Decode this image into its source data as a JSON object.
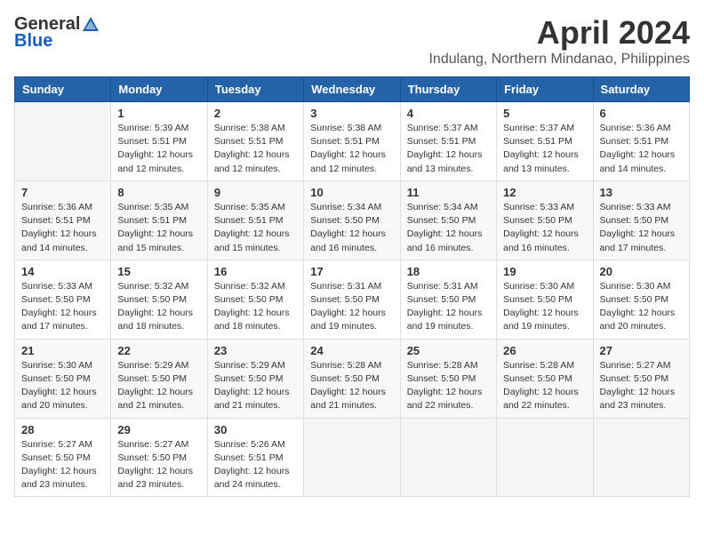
{
  "logo": {
    "general": "General",
    "blue": "Blue"
  },
  "title": "April 2024",
  "location": "Indulang, Northern Mindanao, Philippines",
  "days_of_week": [
    "Sunday",
    "Monday",
    "Tuesday",
    "Wednesday",
    "Thursday",
    "Friday",
    "Saturday"
  ],
  "weeks": [
    [
      {
        "day": "",
        "info": ""
      },
      {
        "day": "1",
        "info": "Sunrise: 5:39 AM\nSunset: 5:51 PM\nDaylight: 12 hours\nand 12 minutes."
      },
      {
        "day": "2",
        "info": "Sunrise: 5:38 AM\nSunset: 5:51 PM\nDaylight: 12 hours\nand 12 minutes."
      },
      {
        "day": "3",
        "info": "Sunrise: 5:38 AM\nSunset: 5:51 PM\nDaylight: 12 hours\nand 12 minutes."
      },
      {
        "day": "4",
        "info": "Sunrise: 5:37 AM\nSunset: 5:51 PM\nDaylight: 12 hours\nand 13 minutes."
      },
      {
        "day": "5",
        "info": "Sunrise: 5:37 AM\nSunset: 5:51 PM\nDaylight: 12 hours\nand 13 minutes."
      },
      {
        "day": "6",
        "info": "Sunrise: 5:36 AM\nSunset: 5:51 PM\nDaylight: 12 hours\nand 14 minutes."
      }
    ],
    [
      {
        "day": "7",
        "info": "Sunrise: 5:36 AM\nSunset: 5:51 PM\nDaylight: 12 hours\nand 14 minutes."
      },
      {
        "day": "8",
        "info": "Sunrise: 5:35 AM\nSunset: 5:51 PM\nDaylight: 12 hours\nand 15 minutes."
      },
      {
        "day": "9",
        "info": "Sunrise: 5:35 AM\nSunset: 5:51 PM\nDaylight: 12 hours\nand 15 minutes."
      },
      {
        "day": "10",
        "info": "Sunrise: 5:34 AM\nSunset: 5:50 PM\nDaylight: 12 hours\nand 16 minutes."
      },
      {
        "day": "11",
        "info": "Sunrise: 5:34 AM\nSunset: 5:50 PM\nDaylight: 12 hours\nand 16 minutes."
      },
      {
        "day": "12",
        "info": "Sunrise: 5:33 AM\nSunset: 5:50 PM\nDaylight: 12 hours\nand 16 minutes."
      },
      {
        "day": "13",
        "info": "Sunrise: 5:33 AM\nSunset: 5:50 PM\nDaylight: 12 hours\nand 17 minutes."
      }
    ],
    [
      {
        "day": "14",
        "info": "Sunrise: 5:33 AM\nSunset: 5:50 PM\nDaylight: 12 hours\nand 17 minutes."
      },
      {
        "day": "15",
        "info": "Sunrise: 5:32 AM\nSunset: 5:50 PM\nDaylight: 12 hours\nand 18 minutes."
      },
      {
        "day": "16",
        "info": "Sunrise: 5:32 AM\nSunset: 5:50 PM\nDaylight: 12 hours\nand 18 minutes."
      },
      {
        "day": "17",
        "info": "Sunrise: 5:31 AM\nSunset: 5:50 PM\nDaylight: 12 hours\nand 19 minutes."
      },
      {
        "day": "18",
        "info": "Sunrise: 5:31 AM\nSunset: 5:50 PM\nDaylight: 12 hours\nand 19 minutes."
      },
      {
        "day": "19",
        "info": "Sunrise: 5:30 AM\nSunset: 5:50 PM\nDaylight: 12 hours\nand 19 minutes."
      },
      {
        "day": "20",
        "info": "Sunrise: 5:30 AM\nSunset: 5:50 PM\nDaylight: 12 hours\nand 20 minutes."
      }
    ],
    [
      {
        "day": "21",
        "info": "Sunrise: 5:30 AM\nSunset: 5:50 PM\nDaylight: 12 hours\nand 20 minutes."
      },
      {
        "day": "22",
        "info": "Sunrise: 5:29 AM\nSunset: 5:50 PM\nDaylight: 12 hours\nand 21 minutes."
      },
      {
        "day": "23",
        "info": "Sunrise: 5:29 AM\nSunset: 5:50 PM\nDaylight: 12 hours\nand 21 minutes."
      },
      {
        "day": "24",
        "info": "Sunrise: 5:28 AM\nSunset: 5:50 PM\nDaylight: 12 hours\nand 21 minutes."
      },
      {
        "day": "25",
        "info": "Sunrise: 5:28 AM\nSunset: 5:50 PM\nDaylight: 12 hours\nand 22 minutes."
      },
      {
        "day": "26",
        "info": "Sunrise: 5:28 AM\nSunset: 5:50 PM\nDaylight: 12 hours\nand 22 minutes."
      },
      {
        "day": "27",
        "info": "Sunrise: 5:27 AM\nSunset: 5:50 PM\nDaylight: 12 hours\nand 23 minutes."
      }
    ],
    [
      {
        "day": "28",
        "info": "Sunrise: 5:27 AM\nSunset: 5:50 PM\nDaylight: 12 hours\nand 23 minutes."
      },
      {
        "day": "29",
        "info": "Sunrise: 5:27 AM\nSunset: 5:50 PM\nDaylight: 12 hours\nand 23 minutes."
      },
      {
        "day": "30",
        "info": "Sunrise: 5:26 AM\nSunset: 5:51 PM\nDaylight: 12 hours\nand 24 minutes."
      },
      {
        "day": "",
        "info": ""
      },
      {
        "day": "",
        "info": ""
      },
      {
        "day": "",
        "info": ""
      },
      {
        "day": "",
        "info": ""
      }
    ]
  ]
}
